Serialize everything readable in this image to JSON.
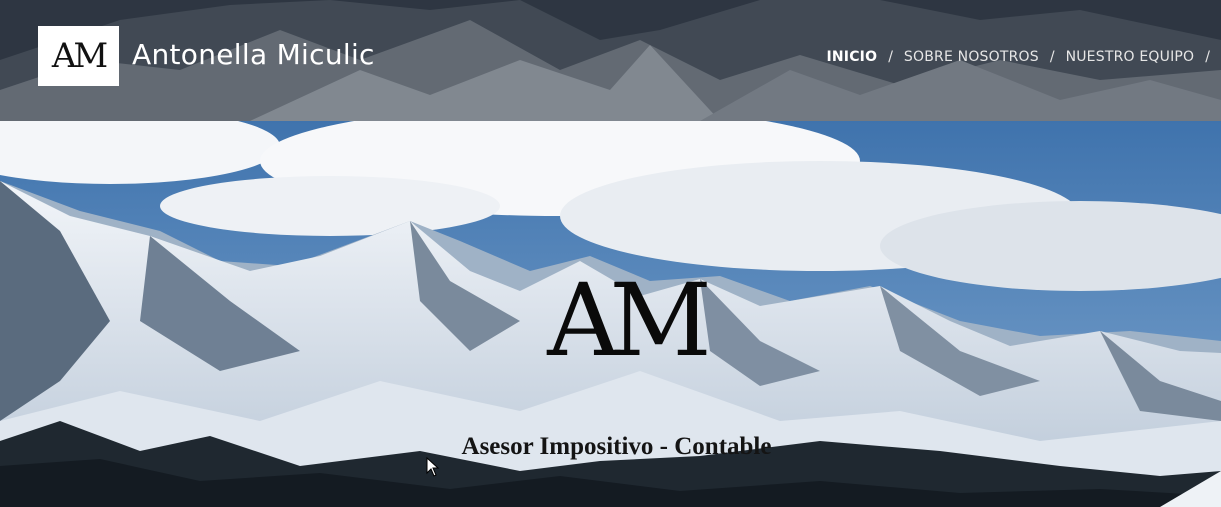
{
  "header": {
    "logo_text": "AM",
    "site_title": "Antonella Miculic",
    "nav": [
      {
        "label": "INICIO",
        "active": true
      },
      {
        "label": "SOBRE NOSOTROS",
        "active": false
      },
      {
        "label": "NUESTRO EQUIPO",
        "active": false
      }
    ],
    "nav_separator": "/"
  },
  "hero": {
    "logo_text": "AM",
    "tagline": "Asesor Impositivo - Contable"
  },
  "colors": {
    "header_overlay": "#2a313b",
    "sky": "#4f7fb4",
    "snow": "#e8eef5",
    "text_dark": "#111111"
  }
}
